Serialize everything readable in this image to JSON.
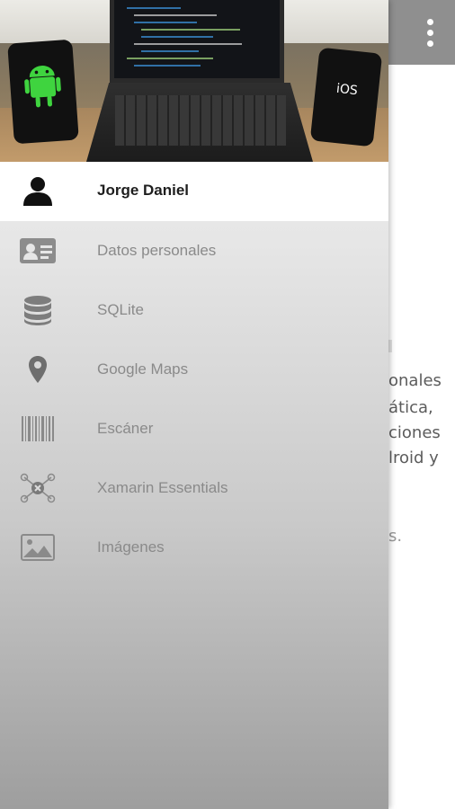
{
  "app": {
    "toolbar_color": "#8f8f8f",
    "overflow_icon": "more-vertical-icon"
  },
  "background_text": {
    "line1": "onales",
    "line2": "ática,",
    "line3": "ciones",
    "line4": "lroid y",
    "line5": "s."
  },
  "drawer": {
    "header_image": "laptop-with-android-and-ios-phones",
    "phone_right_label": "iOS",
    "user": {
      "name": "Jorge Daniel",
      "icon": "person-icon"
    },
    "items": [
      {
        "label": "Datos personales",
        "icon": "id-card-icon"
      },
      {
        "label": "SQLite",
        "icon": "database-icon"
      },
      {
        "label": "Google Maps",
        "icon": "location-pin-icon"
      },
      {
        "label": "Escáner",
        "icon": "barcode-icon"
      },
      {
        "label": "Xamarin Essentials",
        "icon": "xamarin-icon"
      },
      {
        "label": "Imágenes",
        "icon": "image-icon"
      }
    ]
  }
}
